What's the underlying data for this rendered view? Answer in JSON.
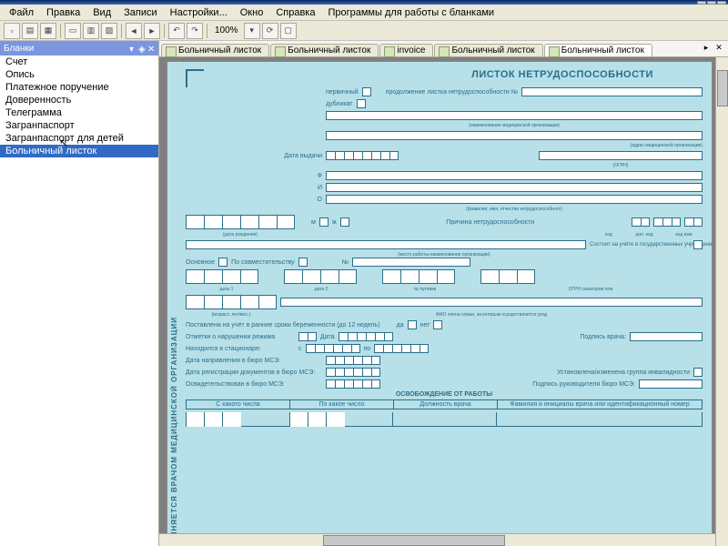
{
  "menu": {
    "file": "Файл",
    "edit": "Правка",
    "view": "Вид",
    "records": "Записи",
    "settings": "Настройки...",
    "window": "Окно",
    "help": "Справка",
    "programs": "Программы для работы с бланками"
  },
  "toolbar": {
    "zoom": "100%"
  },
  "sidebar": {
    "title": "Бланки",
    "items": [
      "Счет",
      "Опись",
      "Платежное поручение",
      "Доверенность",
      "Телеграмма",
      "Загранпаспорт",
      "Загранпаспорт для детей",
      "Больничный листок"
    ],
    "selected": 7
  },
  "tabs": {
    "items": [
      "Больничный листок",
      "Больничный листок",
      "invoice",
      "Больничный листок",
      "Больничный листок"
    ],
    "active": 4
  },
  "form": {
    "title": "ЛИСТОК НЕТРУДОСПОСОБНОСТИ",
    "primary": "первичный",
    "duplicate": "дубликат",
    "continuation": "продолжение листка нетрудоспособности №",
    "org_hint": "(наименование медицинской организации)",
    "addr_hint": "(адрес медицинской организации)",
    "date_issue": "Дата выдачи",
    "ogrn": "(ОГРН)",
    "f": "Ф",
    "i": "И",
    "o": "О",
    "fio_hint": "(фамилия, имя, отчество нетрудоспособного)",
    "dob_hint": "(дата рождения)",
    "m": "м",
    "zh": "ж",
    "reason": "Причина нетрудоспособности",
    "code": "код",
    "add_code": "доп. код",
    "change": "код изм.",
    "work_hint": "(место работы-наименование организации)",
    "main": "Основное",
    "combo": "По совместительству",
    "num": "№",
    "registered": "Состоит на учёте в государственных учреждениях службы занятости",
    "date1": "дата 1",
    "date2": "дата 2",
    "voucher": "№ путевки",
    "ogrn_san": "ОГРН санатория или",
    "care_hint": "(возраст, лет/мес.)",
    "fio_care": "ФИО члена семьи, за которым осуществляется уход",
    "early_reg": "Поставлена на учёт в ранние сроки беременности (до 12 недель)",
    "yes": "да",
    "no": "нет",
    "violations": "Отметки о нарушении режима",
    "date": "Дата",
    "doctor_sign": "Подпись врача:",
    "hospital": "Находился в стационаре:",
    "from": "с",
    "to": "по",
    "mse_dir": "Дата направления в бюро МСЭ:",
    "mse_reg": "Дата регистрации документов в бюро МСЭ:",
    "disability": "Установлена/изменена группа инвалидности",
    "mse_exam": "Освидетельствован в бюро МСЭ:",
    "mse_head": "Подпись руководителя бюро МСЭ:",
    "release": "ОСВОБОЖДЕНИЕ ОТ РАБОТЫ",
    "col1": "С какого числа",
    "col2": "По какое число",
    "col3": "Должность врача",
    "col4": "Фамилия и инициалы врача или идентификационный номер",
    "vtext": "ЛНЯЕТСЯ ВРАЧОМ МЕДИЦИНСКОЙ ОРГАНИЗАЦИИ"
  }
}
